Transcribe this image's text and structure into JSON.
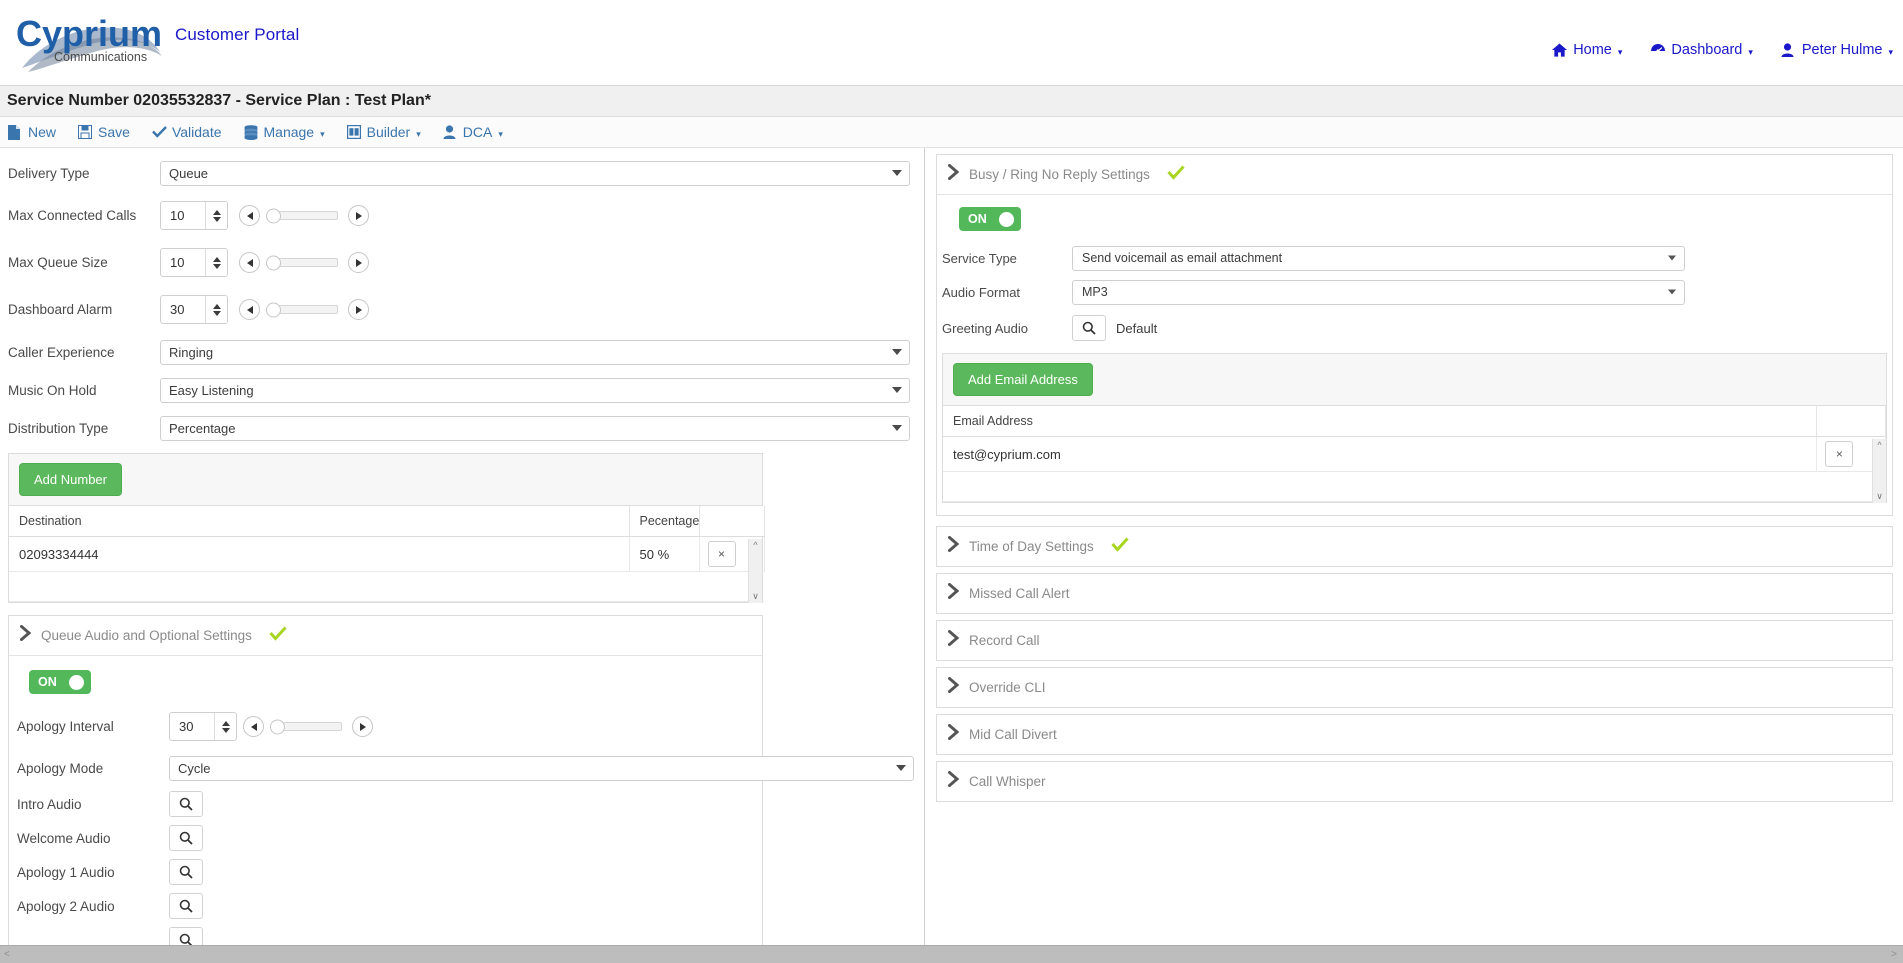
{
  "header": {
    "logo_main": "Cyprium",
    "logo_sub": "Communications",
    "portal_title": "Customer Portal",
    "nav": [
      {
        "label": "Home",
        "icon": "home-icon",
        "caret": "▾"
      },
      {
        "label": "Dashboard",
        "icon": "dashboard-icon",
        "caret": "▾"
      },
      {
        "label": "Peter Hulme",
        "icon": "user-icon",
        "caret": "▾"
      }
    ]
  },
  "page": {
    "title": "Service Number 02035532837 - Service Plan : Test Plan*"
  },
  "toolbar": {
    "items": [
      {
        "label": "New",
        "icon": "file-icon",
        "caret": ""
      },
      {
        "label": "Save",
        "icon": "floppy-icon",
        "caret": ""
      },
      {
        "label": "Validate",
        "icon": "check-icon",
        "caret": ""
      },
      {
        "label": "Manage",
        "icon": "database-icon",
        "caret": "▾"
      },
      {
        "label": "Builder",
        "icon": "window-icon",
        "caret": "▾"
      },
      {
        "label": "DCA",
        "icon": "user-icon",
        "caret": "▾"
      }
    ]
  },
  "left": {
    "delivery_type": {
      "label": "Delivery Type",
      "value": "Queue"
    },
    "max_connected_calls": {
      "label": "Max Connected Calls",
      "value": "10"
    },
    "max_queue_size": {
      "label": "Max Queue Size",
      "value": "10"
    },
    "dashboard_alarm": {
      "label": "Dashboard Alarm",
      "value": "30"
    },
    "caller_experience": {
      "label": "Caller Experience",
      "value": "Ringing"
    },
    "music_on_hold": {
      "label": "Music On Hold",
      "value": "Easy Listening"
    },
    "distribution_type": {
      "label": "Distribution Type",
      "value": "Percentage"
    },
    "add_number_button": "Add Number",
    "destinations_table": {
      "columns": [
        "Destination",
        "Pecentage",
        ""
      ],
      "rows": [
        {
          "destination": "02093334444",
          "percentage": "50 %",
          "remove": "×"
        }
      ]
    },
    "queue_audio": {
      "title": "Queue Audio and Optional Settings",
      "status_icon": "green-check-icon",
      "toggle": "ON",
      "apology_interval": {
        "label": "Apology Interval",
        "value": "30"
      },
      "apology_mode": {
        "label": "Apology Mode",
        "value": "Cycle"
      },
      "audio_pickers": [
        {
          "label": "Intro Audio",
          "icon": "search-icon"
        },
        {
          "label": "Welcome Audio",
          "icon": "search-icon"
        },
        {
          "label": "Apology 1 Audio",
          "icon": "search-icon"
        },
        {
          "label": "Apology 2 Audio",
          "icon": "search-icon"
        }
      ]
    }
  },
  "right": {
    "busy_section": {
      "title": "Busy / Ring No Reply Settings",
      "status_icon": "green-check-icon",
      "toggle": "ON",
      "service_type": {
        "label": "Service Type",
        "value": "Send voicemail as email attachment"
      },
      "audio_format": {
        "label": "Audio Format",
        "value": "MP3"
      },
      "greeting_audio": {
        "label": "Greeting Audio",
        "value": "Default",
        "icon": "search-icon"
      },
      "add_email_button": "Add Email Address",
      "email_table": {
        "columns": [
          "Email Address",
          ""
        ],
        "rows": [
          {
            "email": "test@cyprium.com",
            "remove": "×"
          }
        ]
      }
    },
    "sections": [
      {
        "title": "Time of Day Settings",
        "has_tick": true
      },
      {
        "title": "Missed Call Alert",
        "has_tick": false
      },
      {
        "title": "Record Call",
        "has_tick": false
      },
      {
        "title": "Override CLI",
        "has_tick": false
      },
      {
        "title": "Mid Call Divert",
        "has_tick": false
      },
      {
        "title": "Call Whisper",
        "has_tick": false
      }
    ]
  },
  "colors": {
    "brand_blue": "#1a18c8",
    "toolbar_blue": "#3a75ad",
    "green": "#5cb85c",
    "tick_green": "#a8d520",
    "scrollbar": "#bdbdbd"
  }
}
